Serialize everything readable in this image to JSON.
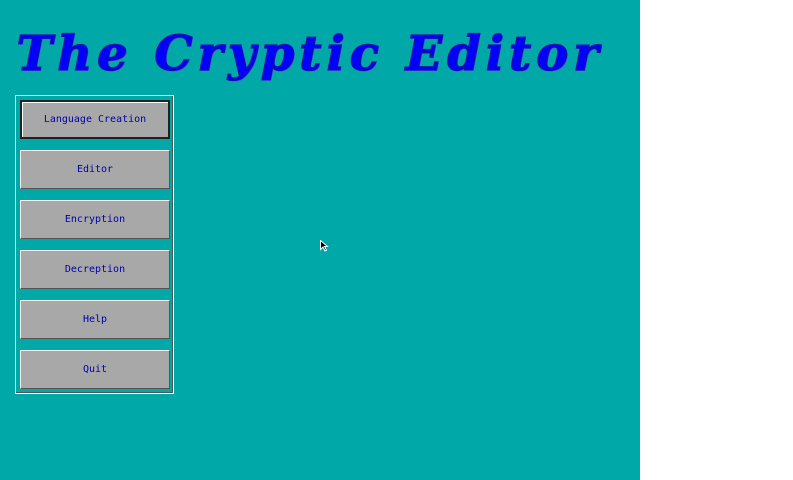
{
  "app": {
    "title": "The Cryptic Editor"
  },
  "menu": {
    "items": [
      {
        "label": "Language Creation",
        "selected": true
      },
      {
        "label": "Editor"
      },
      {
        "label": "Encryption"
      },
      {
        "label": "Decreption"
      },
      {
        "label": "Help"
      },
      {
        "label": "Quit"
      }
    ]
  },
  "colors": {
    "background": "#00a8a8",
    "button_face": "#a8a8a8",
    "button_text": "#0000a8",
    "title": "#0000ff"
  },
  "icons": {
    "pointer": "mouse-pointer-icon"
  }
}
